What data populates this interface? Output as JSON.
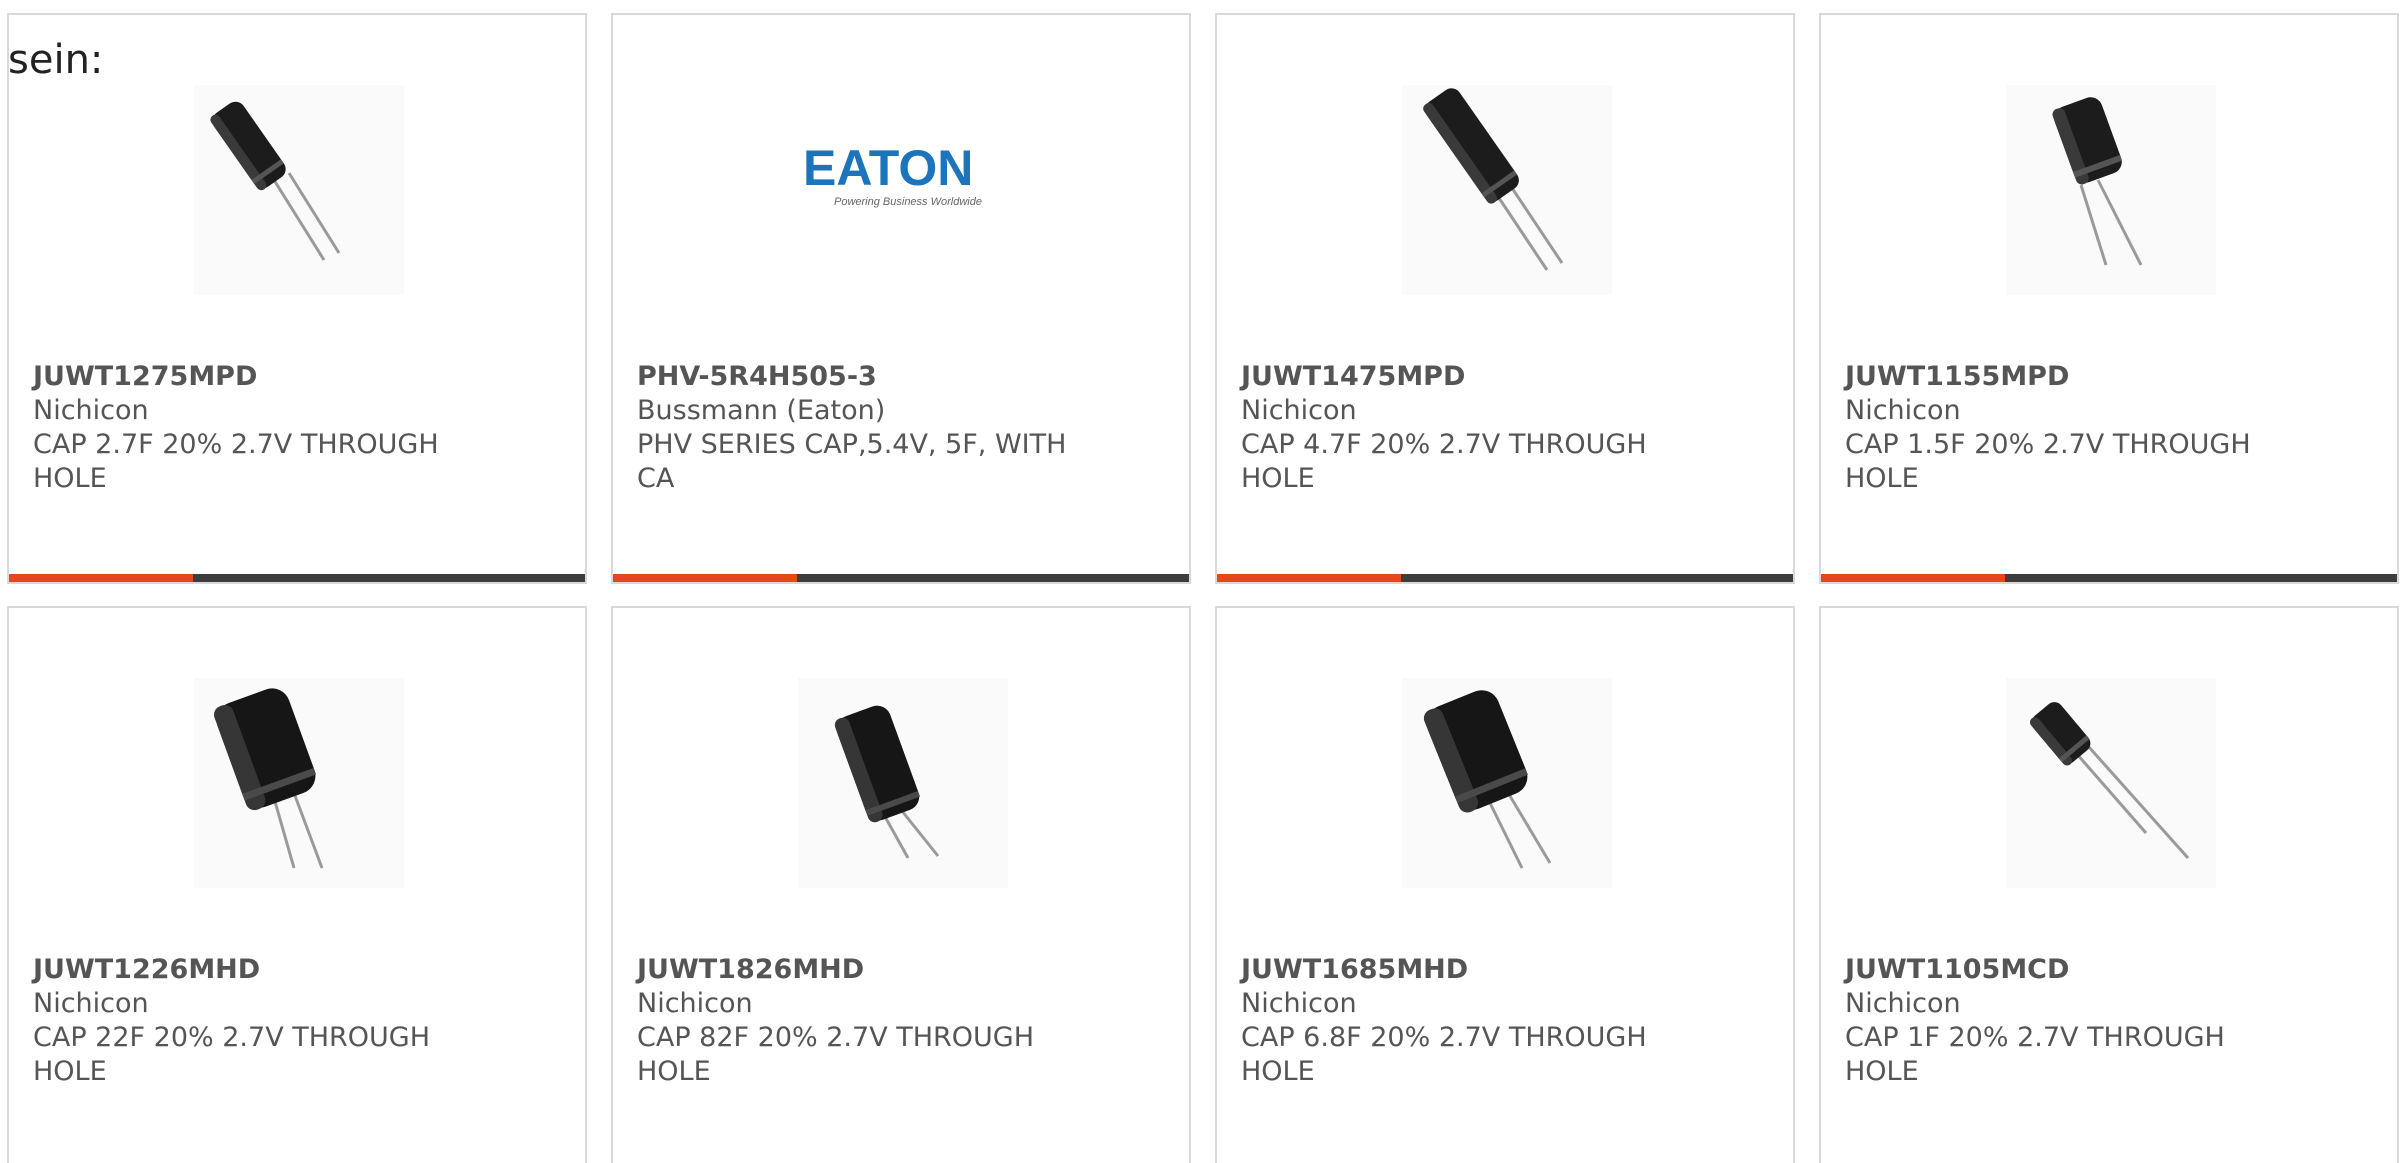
{
  "top_label": "sein:",
  "colors": {
    "accent": "#e8461b",
    "bar_track": "#3d3d3d",
    "card_border": "#d9d9d9",
    "text": "#555555",
    "eaton_blue": "#1c75bc"
  },
  "products": [
    {
      "part": "JUWT1275MPD",
      "manufacturer": "Nichicon",
      "description": "CAP 2.7F 20% 2.7V THROUGH HOLE",
      "image": "capacitor-slim-icon",
      "progress": 0.32
    },
    {
      "part": "PHV-5R4H505-3",
      "manufacturer": "Bussmann (Eaton)",
      "description": "PHV SERIES CAP,5.4V, 5F, WITH CA",
      "image": "eaton-logo",
      "logo_text": "EATON",
      "logo_tagline": "Powering Business Worldwide",
      "progress": 0.32
    },
    {
      "part": "JUWT1475MPD",
      "manufacturer": "Nichicon",
      "description": "CAP 4.7F 20% 2.7V THROUGH HOLE",
      "image": "capacitor-long-icon",
      "progress": 0.32
    },
    {
      "part": "JUWT1155MPD",
      "manufacturer": "Nichicon",
      "description": "CAP 1.5F 20% 2.7V THROUGH HOLE",
      "image": "capacitor-short-icon",
      "progress": 0.32
    },
    {
      "part": "JUWT1226MHD",
      "manufacturer": "Nichicon",
      "description": "CAP 22F 20% 2.7V THROUGH HOLE",
      "image": "capacitor-wide-icon"
    },
    {
      "part": "JUWT1826MHD",
      "manufacturer": "Nichicon",
      "description": "CAP 82F 20% 2.7V THROUGH HOLE",
      "image": "capacitor-wide-icon"
    },
    {
      "part": "JUWT1685MHD",
      "manufacturer": "Nichicon",
      "description": "CAP 6.8F 20% 2.7V THROUGH HOLE",
      "image": "capacitor-wide-icon"
    },
    {
      "part": "JUWT1105MCD",
      "manufacturer": "Nichicon",
      "description": "CAP 1F 20% 2.7V THROUGH HOLE",
      "image": "capacitor-small-icon"
    }
  ]
}
